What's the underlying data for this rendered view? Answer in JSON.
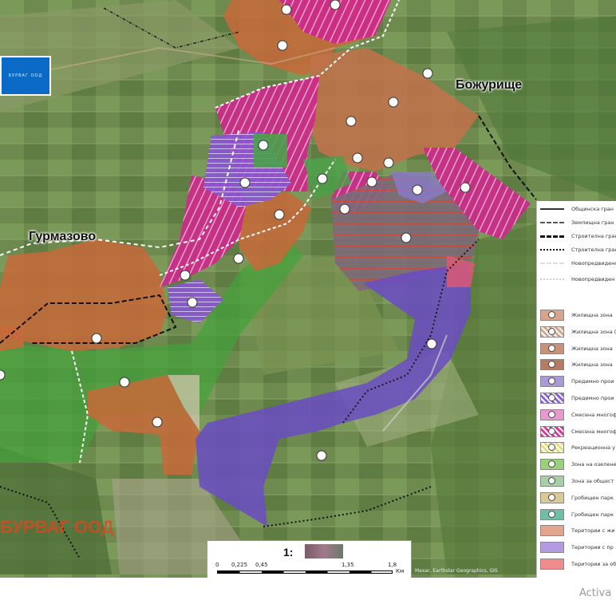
{
  "map": {
    "towns": [
      {
        "id": "bozhurishte",
        "name": "Божурище"
      },
      {
        "id": "gurmazovo",
        "name": "Гурмазово"
      }
    ]
  },
  "branding": {
    "logo_text": "БУРВАГ ООД",
    "watermark_text": "БУРВАГ ООД"
  },
  "legend": {
    "lines": [
      {
        "label": "Общинска гран",
        "style": "solid-cross"
      },
      {
        "label": "Землищна гран",
        "style": "dash-dot"
      },
      {
        "label": "Строителна гран",
        "style": "dashed-bold"
      },
      {
        "label": "Строителна гран",
        "style": "dotted"
      },
      {
        "label": "Новопредвидено място",
        "style": "white-dash"
      },
      {
        "label": "Новопредвиден образувания",
        "style": "white-dot"
      }
    ],
    "zones": [
      {
        "label": "Жилищна зона",
        "color": "#d8a58c",
        "hatch": false
      },
      {
        "label": "Жилищна зона (проект)",
        "color": "#d8a58c",
        "hatch": true
      },
      {
        "label": "Жилищна зона",
        "color": "#c99178",
        "hatch": false
      },
      {
        "label": "Жилищна зона",
        "color": "#b77a62",
        "hatch": false
      },
      {
        "label": "Предимно прои",
        "color": "#a99bd6",
        "hatch": false
      },
      {
        "label": "Предимно прои зона (проект)",
        "color": "#8e63d8",
        "hatch": true
      },
      {
        "label": "Смесена многоф",
        "color": "#e79ad0",
        "hatch": false
      },
      {
        "label": "Смесена многоф",
        "color": "#d23c9a",
        "hatch": true
      },
      {
        "label": "Рекреационна у отдих (проект)",
        "color": "#e3e07a",
        "hatch": true
      },
      {
        "label": "Зона на озеленен",
        "color": "#9ad17a",
        "hatch": false
      },
      {
        "label": "Зона за общест и смесен",
        "color": "#a7cfa5",
        "hatch": false
      },
      {
        "label": "Гробищен парк",
        "color": "#d8c996",
        "hatch": false
      },
      {
        "label": "Гробищен парк",
        "color": "#6fbfa8",
        "hatch": false
      },
      {
        "label": "Територии с жи",
        "color": "#e4a58f",
        "hatch": false
      },
      {
        "label": "Територии с пр",
        "color": "#b49ae0",
        "hatch": false
      },
      {
        "label": "Територии за об функция",
        "color": "#f28b8b",
        "hatch": false
      }
    ]
  },
  "scale": {
    "title": "1:",
    "ticks": [
      "0",
      "0,225",
      "0,45",
      "1,35",
      "1,8"
    ],
    "unit": "Км"
  },
  "attribution": "Maxar, Earthstar Geographics, GIS",
  "os_overlay": "Activa"
}
